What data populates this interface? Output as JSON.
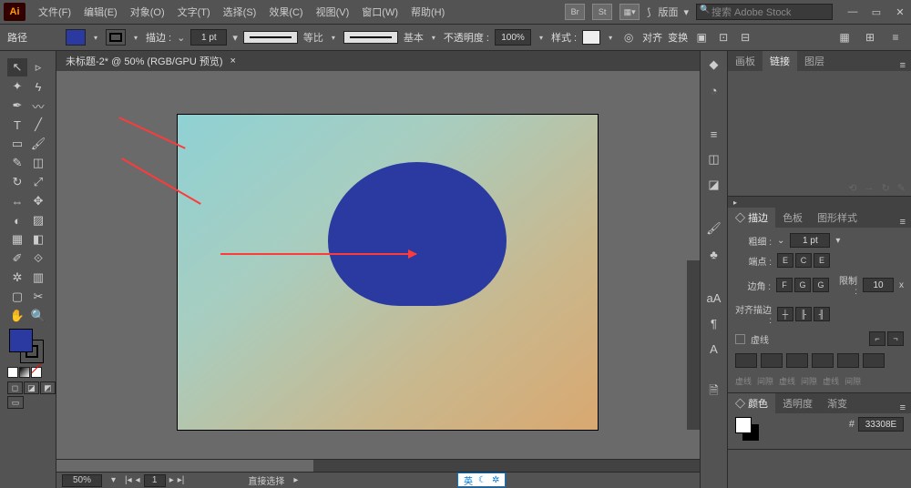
{
  "app": {
    "logo": "Ai"
  },
  "menu": {
    "file": "文件(F)",
    "edit": "编辑(E)",
    "object": "对象(O)",
    "type": "文字(T)",
    "select": "选择(S)",
    "effect": "效果(C)",
    "view": "视图(V)",
    "window": "窗口(W)",
    "help": "帮助(H)"
  },
  "title_btns": {
    "br": "Br",
    "st": "St"
  },
  "workspace": {
    "label": "版面",
    "arrow": "▾"
  },
  "search": {
    "placeholder": "搜索 Adobe Stock"
  },
  "win": {
    "min": "—",
    "max": "▭",
    "close": "✕"
  },
  "options": {
    "path": "路径",
    "stroke_lbl": "描边 :",
    "weight": "1 pt",
    "uniform": "等比",
    "basic": "基本",
    "opacity_lbl": "不透明度 :",
    "opacity_val": "100%",
    "style_lbl": "样式 :",
    "align_lbl": "对齐",
    "transform_lbl": "变换"
  },
  "doc": {
    "title": "未标题-2* @ 50% (RGB/GPU 预览)",
    "close": "×"
  },
  "status": {
    "zoom": "50%",
    "page": "1",
    "tool": "直接选择",
    "nav": {
      "first": "|◂",
      "prev": "◂",
      "next": "▸",
      "last": "▸|"
    },
    "lang": {
      "txt": "英",
      "moon": "☾",
      "gear": "✲"
    }
  },
  "right": {
    "tabs1": {
      "artboard": "画板",
      "links": "链接",
      "layers": "图层"
    },
    "tabs2": {
      "stroke": "描边",
      "swatches": "色板",
      "graphic": "图形样式"
    },
    "tabs3": {
      "color": "颜色",
      "transparency": "透明度",
      "gradient": "渐变"
    },
    "stroke": {
      "weight_lbl": "粗细 :",
      "weight_val": "1 pt",
      "cap_lbl": "端点 :",
      "corner_lbl": "边角 :",
      "limit_lbl": "限制 :",
      "limit_val": "10",
      "limit_x": "x",
      "align_lbl": "对齐描边 :",
      "dashed_lbl": "虚线",
      "dash_labels": {
        "d1": "虚线",
        "g1": "间隙",
        "d2": "虚线",
        "g2": "间隙",
        "d3": "虚线",
        "g3": "间隙"
      }
    },
    "color": {
      "hash": "#",
      "hex": "33308E"
    }
  },
  "icons": {
    "recolor": "◎",
    "align": "≡",
    "transform": "⇄",
    "crop": "▣",
    "export": "⇪",
    "search2": "🔍",
    "cursor": "↖",
    "lib": "▦",
    "sep": "—",
    "brush": "🖌",
    "char": "A",
    "para": "¶",
    "doc": "🗎"
  }
}
